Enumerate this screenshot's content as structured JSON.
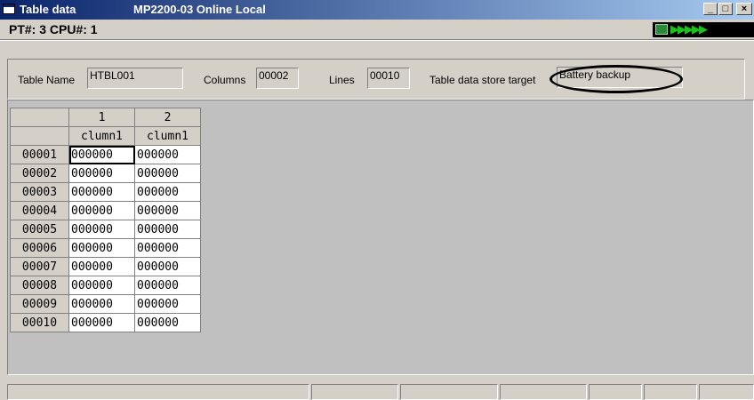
{
  "window": {
    "title": "Table data",
    "subtitle": "MP2200-03 Online Local",
    "buttons": {
      "minimize": "_",
      "restore": "□",
      "close": "×"
    }
  },
  "status": {
    "pt_cpu": "PT#: 3 CPU#: 1",
    "indicator_arrows": "▶▶▶▶▶",
    "indicator_icon": "computer-icon"
  },
  "info": {
    "table_name_label": "Table Name",
    "table_name_value": "HTBL001",
    "columns_label": "Columns",
    "columns_value": "00002",
    "lines_label": "Lines",
    "lines_value": "00010",
    "store_target_label": "Table data store target",
    "store_target_value": "Battery backup"
  },
  "grid": {
    "column_numbers": [
      "1",
      "2"
    ],
    "column_names": [
      "clumn1",
      "clumn1"
    ],
    "rows": [
      {
        "id": "00001",
        "values": [
          "000000",
          "000000"
        ]
      },
      {
        "id": "00002",
        "values": [
          "000000",
          "000000"
        ]
      },
      {
        "id": "00003",
        "values": [
          "000000",
          "000000"
        ]
      },
      {
        "id": "00004",
        "values": [
          "000000",
          "000000"
        ]
      },
      {
        "id": "00005",
        "values": [
          "000000",
          "000000"
        ]
      },
      {
        "id": "00006",
        "values": [
          "000000",
          "000000"
        ]
      },
      {
        "id": "00007",
        "values": [
          "000000",
          "000000"
        ]
      },
      {
        "id": "00008",
        "values": [
          "000000",
          "000000"
        ]
      },
      {
        "id": "00009",
        "values": [
          "000000",
          "000000"
        ]
      },
      {
        "id": "00010",
        "values": [
          "000000",
          "000000"
        ]
      }
    ]
  },
  "colors": {
    "title_start": "#0a246a",
    "title_end": "#a6caf0",
    "face": "#d4d0c8",
    "indicator_green": "#1cc21c"
  }
}
